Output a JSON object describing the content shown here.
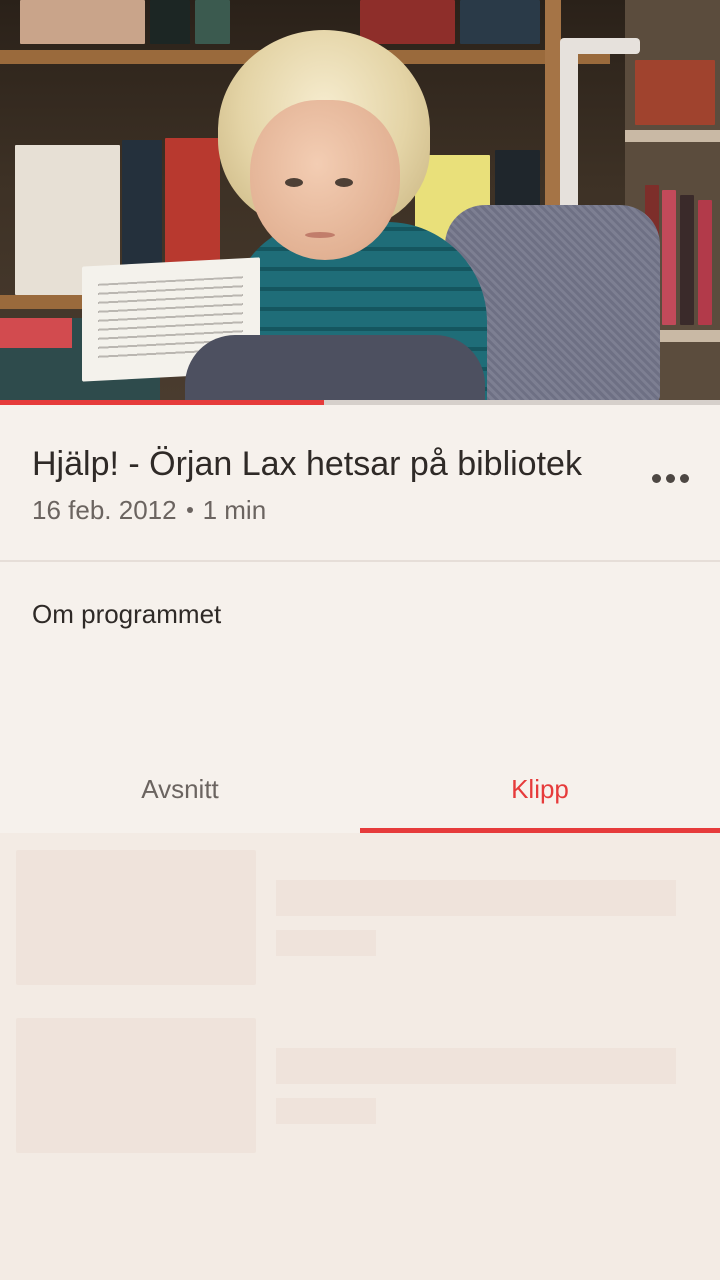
{
  "video": {
    "description_icon": "video-thumbnail",
    "progress_percent": 45
  },
  "program": {
    "title": "Hjälp! - Örjan Lax hetsar på bibliotek",
    "date": "16 feb. 2012",
    "duration": "1 min",
    "more_icon": "more-dots-icon"
  },
  "about": {
    "label": "Om programmet"
  },
  "tabs": [
    {
      "label": "Avsnitt",
      "selected": false
    },
    {
      "label": "Klipp",
      "selected": true
    }
  ],
  "colors": {
    "accent": "#e63b3b",
    "background": "#f6f1ec",
    "skeleton": "#efe3db"
  },
  "list": {
    "state": "loading"
  }
}
